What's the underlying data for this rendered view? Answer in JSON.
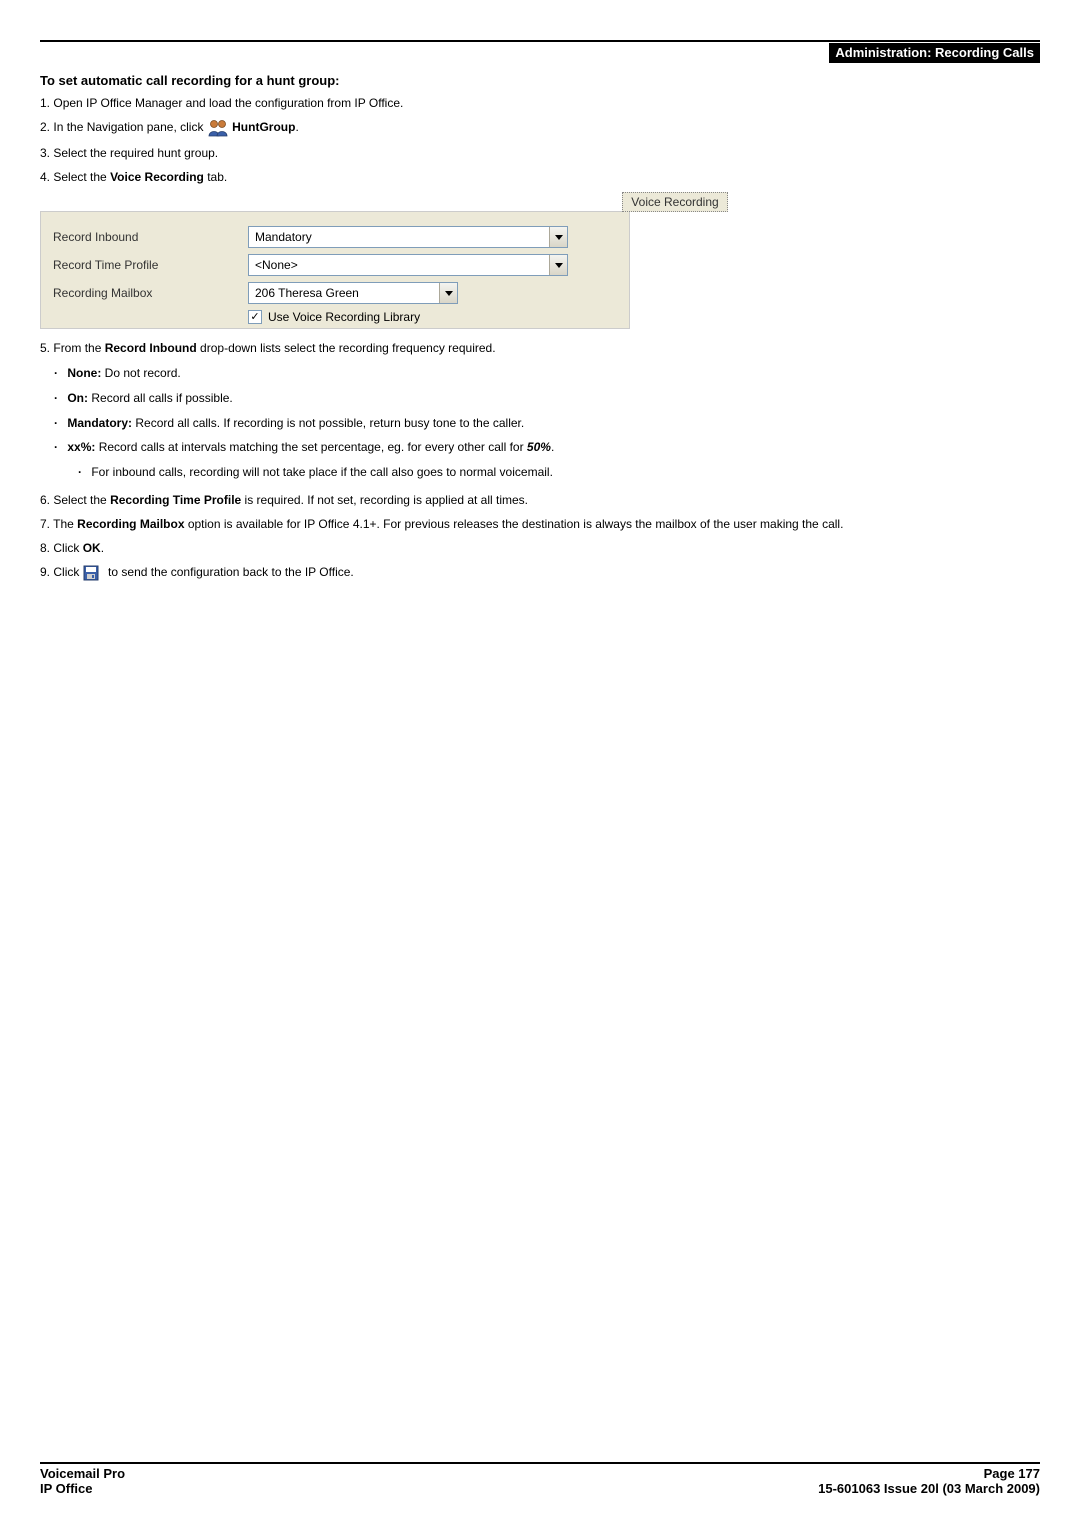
{
  "header": {
    "section": "Administration: Recording Calls"
  },
  "title": "To set automatic call recording for a hunt group:",
  "steps": {
    "s1": {
      "num": "1.",
      "text": "Open IP Office Manager and load the configuration from IP Office."
    },
    "s2": {
      "num": "2.",
      "pre": "In the Navigation pane, click ",
      "bold": "HuntGroup",
      "post": "."
    },
    "s3": {
      "num": "3.",
      "text": "Select the required hunt group."
    },
    "s4": {
      "num": "4.",
      "pre": "Select the ",
      "bold": "Voice Recording",
      "post": " tab."
    },
    "s5": {
      "num": "5.",
      "pre": "From the ",
      "bold": "Record Inbound",
      "post": " drop-down lists select the recording frequency required."
    },
    "s6": {
      "num": "6.",
      "pre": "Select the ",
      "bold": "Recording Time Profile",
      "post": " is required. If not set, recording is applied at all times."
    },
    "s7": {
      "num": "7.",
      "pre": "The ",
      "bold": "Recording Mailbox",
      "post": " option is available for IP Office 4.1+. For previous releases the destination is always the mailbox of the user making the call."
    },
    "s8": {
      "num": "8.",
      "pre": "Click ",
      "bold": "OK",
      "post": "."
    },
    "s9": {
      "num": "9.",
      "pre": "Click ",
      "post": " to send the configuration back to the IP Office."
    }
  },
  "bullets": {
    "b1": {
      "bold": "None:",
      "text": " Do not record."
    },
    "b2": {
      "bold": "On:",
      "text": " Record all calls if possible."
    },
    "b3": {
      "bold": "Mandatory:",
      "text": " Record all calls. If recording is not possible, return busy tone to the caller."
    },
    "b4": {
      "bold": "xx%:",
      "text": " Record calls at intervals matching the set percentage, eg. for every other call for ",
      "ital": "50%",
      "post": "."
    },
    "b4a": {
      "text": "For inbound calls, recording will not take place if the call also goes to normal voicemail."
    }
  },
  "panel": {
    "tab": "Voice Recording",
    "rows": {
      "r1": {
        "label": "Record Inbound",
        "value": "Mandatory"
      },
      "r2": {
        "label": "Record Time Profile",
        "value": "<None>"
      },
      "r3": {
        "label": "Recording Mailbox",
        "value": "206 Theresa Green"
      }
    },
    "checkbox": {
      "label": "Use Voice Recording Library",
      "checked": true
    }
  },
  "footer": {
    "left1": "Voicemail Pro",
    "left2": "IP Office",
    "right1": "Page 177",
    "right2": "15-601063 Issue 20l (03 March 2009)"
  }
}
